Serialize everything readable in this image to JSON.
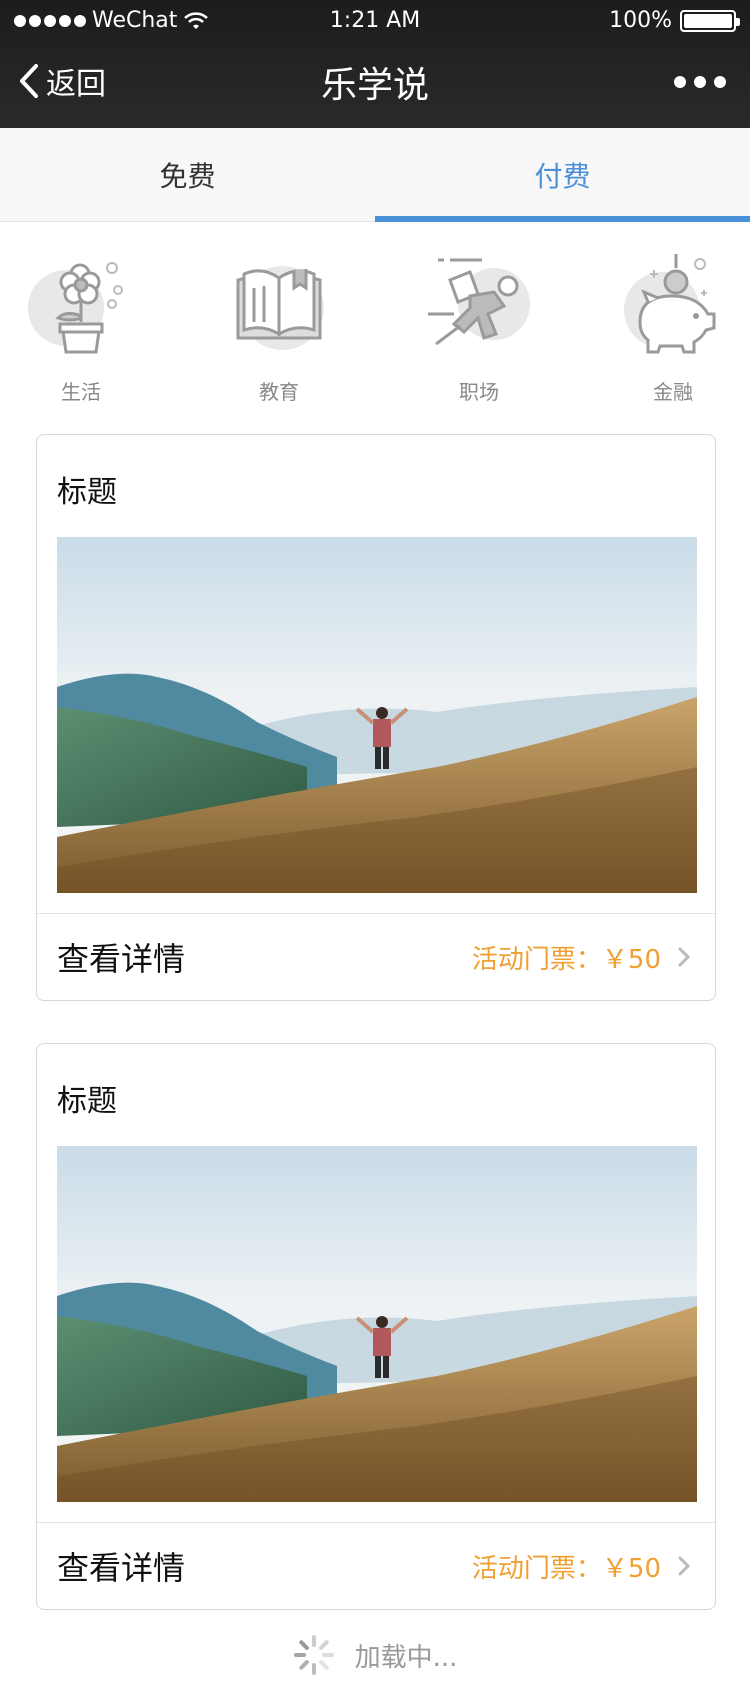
{
  "status_bar": {
    "carrier": "WeChat",
    "time": "1:21 AM",
    "battery": "100%"
  },
  "nav": {
    "back_label": "返回",
    "title": "乐学说"
  },
  "tabs": [
    {
      "label": "免费",
      "active": false
    },
    {
      "label": "付费",
      "active": true
    }
  ],
  "categories": [
    {
      "label": "生活",
      "icon": "flower-pot-icon"
    },
    {
      "label": "教育",
      "icon": "open-book-icon"
    },
    {
      "label": "职场",
      "icon": "running-person-icon"
    },
    {
      "label": "金融",
      "icon": "piggy-bank-icon"
    }
  ],
  "cards": [
    {
      "title": "标题",
      "detail_label": "查看详情",
      "price_label": "活动门票：￥50"
    },
    {
      "title": "标题",
      "detail_label": "查看详情",
      "price_label": "活动门票：￥50"
    }
  ],
  "loading_text": "加载中...",
  "colors": {
    "accent": "#4a90d9",
    "price": "#f0a030",
    "nav_bg": "#222224"
  }
}
